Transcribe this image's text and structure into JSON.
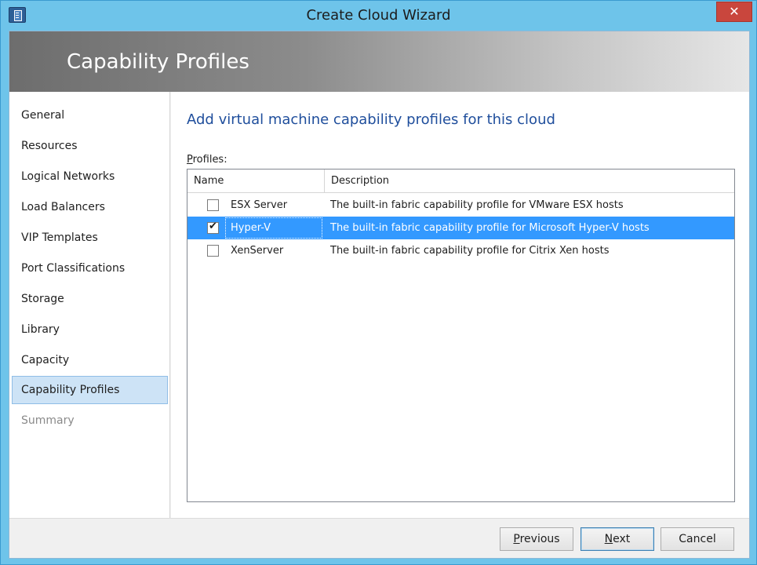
{
  "window": {
    "title": "Create Cloud Wizard",
    "close_label": "✕"
  },
  "banner": {
    "title": "Capability Profiles"
  },
  "sidebar": {
    "items": [
      {
        "label": "General",
        "state": "normal"
      },
      {
        "label": "Resources",
        "state": "normal"
      },
      {
        "label": "Logical Networks",
        "state": "normal"
      },
      {
        "label": "Load Balancers",
        "state": "normal"
      },
      {
        "label": "VIP Templates",
        "state": "normal"
      },
      {
        "label": "Port Classifications",
        "state": "normal"
      },
      {
        "label": "Storage",
        "state": "normal"
      },
      {
        "label": "Library",
        "state": "normal"
      },
      {
        "label": "Capacity",
        "state": "normal"
      },
      {
        "label": "Capability Profiles",
        "state": "active"
      },
      {
        "label": "Summary",
        "state": "disabled"
      }
    ]
  },
  "main": {
    "heading": "Add virtual machine capability profiles for this cloud",
    "profiles_label_accel": "P",
    "profiles_label_rest": "rofiles:",
    "grid": {
      "columns": [
        "Name",
        "Description"
      ],
      "rows": [
        {
          "name": "ESX Server",
          "description": "The built-in fabric capability profile for VMware ESX hosts",
          "checked": false,
          "selected": false
        },
        {
          "name": "Hyper-V",
          "description": "The built-in fabric capability profile for Microsoft Hyper-V hosts",
          "checked": true,
          "selected": true
        },
        {
          "name": "XenServer",
          "description": "The built-in fabric capability profile for Citrix Xen hosts",
          "checked": false,
          "selected": false
        }
      ]
    }
  },
  "footer": {
    "previous_accel": "P",
    "previous_rest": "revious",
    "next_accel": "N",
    "next_rest": "ext",
    "cancel_label": "Cancel"
  },
  "colors": {
    "title_bar": "#6ec4ea",
    "selection": "#3399ff",
    "heading": "#1f4e9c",
    "close_button": "#c9463d"
  }
}
